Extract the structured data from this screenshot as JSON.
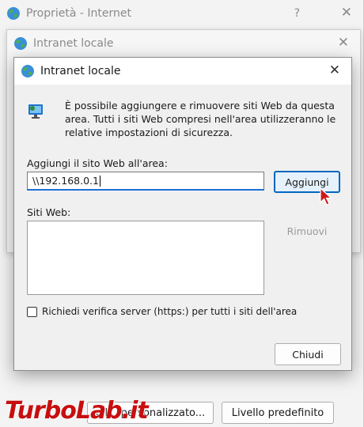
{
  "back_window": {
    "title": "Proprietà - Internet",
    "help_glyph": "?",
    "close_glyph": "✕",
    "buttons": {
      "custom_level": "ell... personalizzato...",
      "default_level": "Livello predefinito"
    }
  },
  "middle_window": {
    "title": "Intranet locale",
    "close_glyph": "✕"
  },
  "dialog": {
    "title": "Intranet locale",
    "close_glyph": "✕",
    "info_text": "È possibile aggiungere e rimuovere siti Web da questa area. Tutti i siti Web compresi nell'area utilizzeranno le relative impostazioni di sicurezza.",
    "add_label": "Aggiungi il sito Web all'area:",
    "add_value": "\\\\192.168.0.1",
    "add_button": "Aggiungi",
    "sites_label": "Siti Web:",
    "sites": [],
    "remove_button": "Rimuovi",
    "https_checkbox_label": "Richiedi verifica server (https:) per tutti i siti dell'area",
    "https_checked": false,
    "close_button": "Chiudi"
  },
  "watermark": {
    "brand": "TurboLab",
    "tld": ".it"
  },
  "colors": {
    "accent": "#0067c0",
    "watermark": "#c70f0f"
  },
  "icons": [
    "globe-icon",
    "network-computer-icon",
    "mouse-cursor-icon"
  ]
}
